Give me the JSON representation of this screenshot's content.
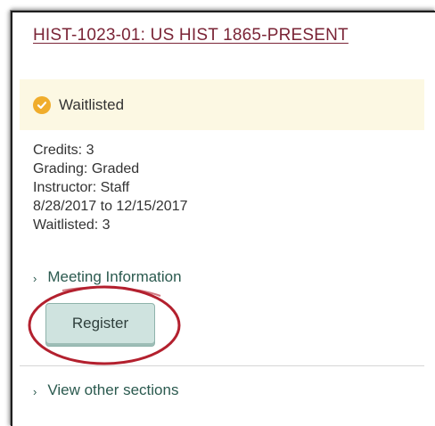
{
  "course": {
    "title": "HIST-1023-01: US HIST 1865-PRESENT"
  },
  "status": {
    "icon": "check-circle-icon",
    "label": "Waitlisted",
    "color": "#f0ad2c",
    "background": "#fcf8e3"
  },
  "details": {
    "credits": "Credits: 3",
    "grading": "Grading: Graded",
    "instructor": "Instructor: Staff",
    "dates": "8/28/2017 to 12/15/2017",
    "waitlisted": "Waitlisted:  3"
  },
  "meeting_information": {
    "label": "Meeting Information",
    "icon": "chevron-right-icon"
  },
  "register": {
    "label": "Register"
  },
  "other_sections": {
    "label": "View other sections",
    "icon": "chevron-right-icon"
  },
  "colors": {
    "title": "#7a2436",
    "link": "#2b5a4f",
    "button": "#cfe3df",
    "highlight": "#b3202e"
  }
}
